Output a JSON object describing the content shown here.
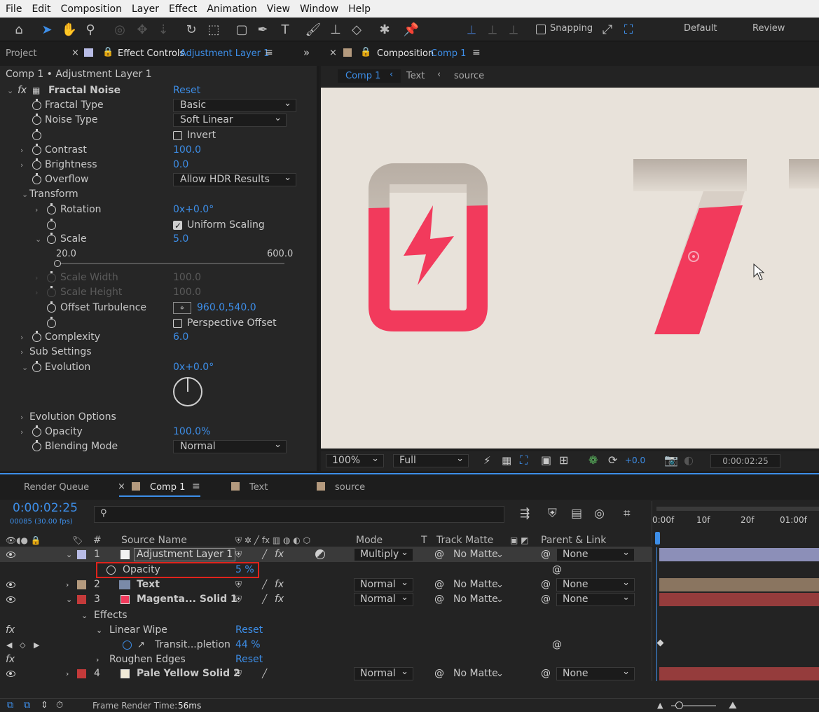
{
  "menu": [
    "File",
    "Edit",
    "Composition",
    "Layer",
    "Effect",
    "Animation",
    "View",
    "Window",
    "Help"
  ],
  "toolbar": {
    "snapping_label": "Snapping",
    "workspace_default": "Default",
    "workspace_review": "Review"
  },
  "left_panel": {
    "tab_project": "Project",
    "tab_effect_controls": "Effect Controls",
    "tab_effect_controls_layer": "Adjustment Layer 1",
    "breadcrumb": "Comp 1 • Adjustment Layer 1",
    "effect_name": "Fractal Noise",
    "reset": "Reset",
    "props": {
      "fractal_type_label": "Fractal Type",
      "fractal_type_value": "Basic",
      "noise_type_label": "Noise Type",
      "noise_type_value": "Soft Linear",
      "invert_label": "Invert",
      "contrast_label": "Contrast",
      "contrast_value": "100.0",
      "brightness_label": "Brightness",
      "brightness_value": "0.0",
      "overflow_label": "Overflow",
      "overflow_value": "Allow HDR Results",
      "transform_label": "Transform",
      "rotation_label": "Rotation",
      "rotation_value": "0x+0.0°",
      "uniform_scaling_label": "Uniform Scaling",
      "scale_label": "Scale",
      "scale_value": "5.0",
      "scale_min": "20.0",
      "scale_max": "600.0",
      "scale_width_label": "Scale Width",
      "scale_width_value": "100.0",
      "scale_height_label": "Scale Height",
      "scale_height_value": "100.0",
      "offset_turbulence_label": "Offset Turbulence",
      "offset_turbulence_value": "960.0,540.0",
      "perspective_offset_label": "Perspective Offset",
      "complexity_label": "Complexity",
      "complexity_value": "6.0",
      "sub_settings_label": "Sub Settings",
      "evolution_label": "Evolution",
      "evolution_value": "0x+0.0°",
      "evolution_options_label": "Evolution Options",
      "opacity_label": "Opacity",
      "opacity_value": "100.0%",
      "blending_mode_label": "Blending Mode",
      "blending_mode_value": "Normal"
    }
  },
  "composition_panel": {
    "tab_label": "Composition",
    "tab_comp": "Comp 1",
    "flow": [
      "Comp 1",
      "Text",
      "source"
    ],
    "zoom": "100%",
    "resolution": "Full",
    "exposure": "+0.0",
    "timecode": "0:00:02:25"
  },
  "timeline": {
    "tabs": [
      "Render Queue",
      "Comp 1",
      "Text",
      "source"
    ],
    "timecode": "0:00:02:25",
    "frame_info": "00085 (30.00 fps)",
    "search_placeholder": "",
    "headers": {
      "num": "#",
      "source_name": "Source Name",
      "mode": "Mode",
      "t": "T",
      "track_matte": "Track Matte",
      "parent_link": "Parent & Link"
    },
    "ruler": [
      "0:00f",
      "10f",
      "20f",
      "01:00f"
    ],
    "layers": [
      {
        "num": "1",
        "name": "Adjustment Layer 1",
        "mode": "Multiply",
        "matte": "No Matte",
        "parent": "None",
        "color": "#b8bce6"
      },
      {
        "num": "2",
        "name": "Text",
        "mode": "Normal",
        "matte": "No Matte",
        "parent": "None",
        "color": "#b49a7e"
      },
      {
        "num": "3",
        "name": "Magenta... Solid 1",
        "mode": "Normal",
        "matte": "No Matte",
        "parent": "None",
        "color": "#c43a3a"
      },
      {
        "num": "4",
        "name": "Pale Yellow Solid 2",
        "mode": "Normal",
        "matte": "No Matte",
        "parent": "None",
        "color": "#c43a3a"
      }
    ],
    "opacity_label": "Opacity",
    "opacity_value": "5 %",
    "effects_label": "Effects",
    "linear_wipe_label": "Linear Wipe",
    "transition_label": "Transit...pletion",
    "transition_value": "44 %",
    "roughen_edges_label": "Roughen Edges",
    "reset": "Reset",
    "status": "Frame Render Time:",
    "render_time": "56ms"
  },
  "colors": {
    "accent": "#3d8ee8",
    "highlight_box": "#e0231c",
    "paper": "#e8e2da",
    "magenta": "#f23a5c"
  }
}
